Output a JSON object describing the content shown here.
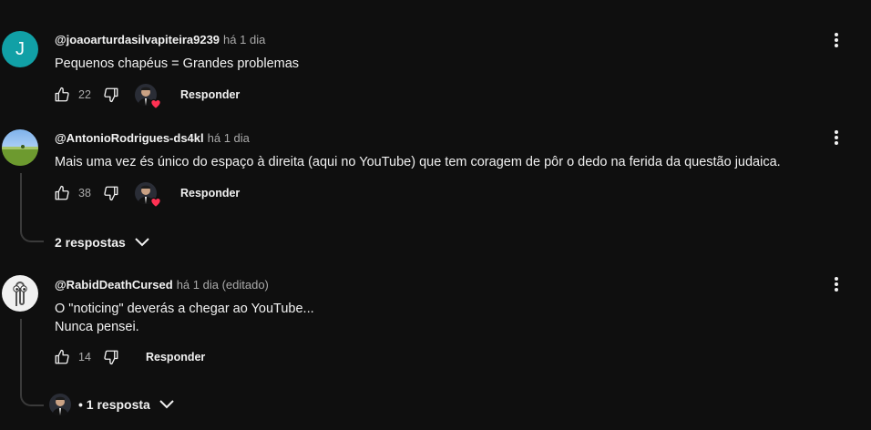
{
  "colors": {
    "background": "#0f0f0f",
    "text": "#f1f1f1",
    "muted": "#aaaaaa",
    "avatar_teal": "#11a0a6",
    "heart": "#ff3153"
  },
  "comments": [
    {
      "avatar_letter": "J",
      "author": "@joaoarturdasilvapiteira9239",
      "time": "há 1 dia",
      "lines": [
        "Pequenos chapéus = Grandes problemas"
      ],
      "likes": "22",
      "reply_label": "Responder",
      "creator_heart": true
    },
    {
      "avatar_icon": "landscape-avatar",
      "author": "@AntonioRodrigues-ds4kl",
      "time": "há 1 dia",
      "lines": [
        "Mais uma vez és único do espaço à direita (aqui no YouTube) que tem coragem de pôr o dedo na ferida da questão judaica."
      ],
      "likes": "38",
      "reply_label": "Responder",
      "creator_heart": true,
      "replies_label": "2 respostas"
    },
    {
      "avatar_icon": "paperclip-avatar",
      "author": "@RabidDeathCursed",
      "time": "há 1 dia (editado)",
      "lines": [
        "O \"noticing\" deverás a chegar ao YouTube...",
        "Nunca pensei."
      ],
      "likes": "14",
      "reply_label": "Responder",
      "creator_heart": false,
      "replies_label": "• 1 resposta"
    }
  ]
}
